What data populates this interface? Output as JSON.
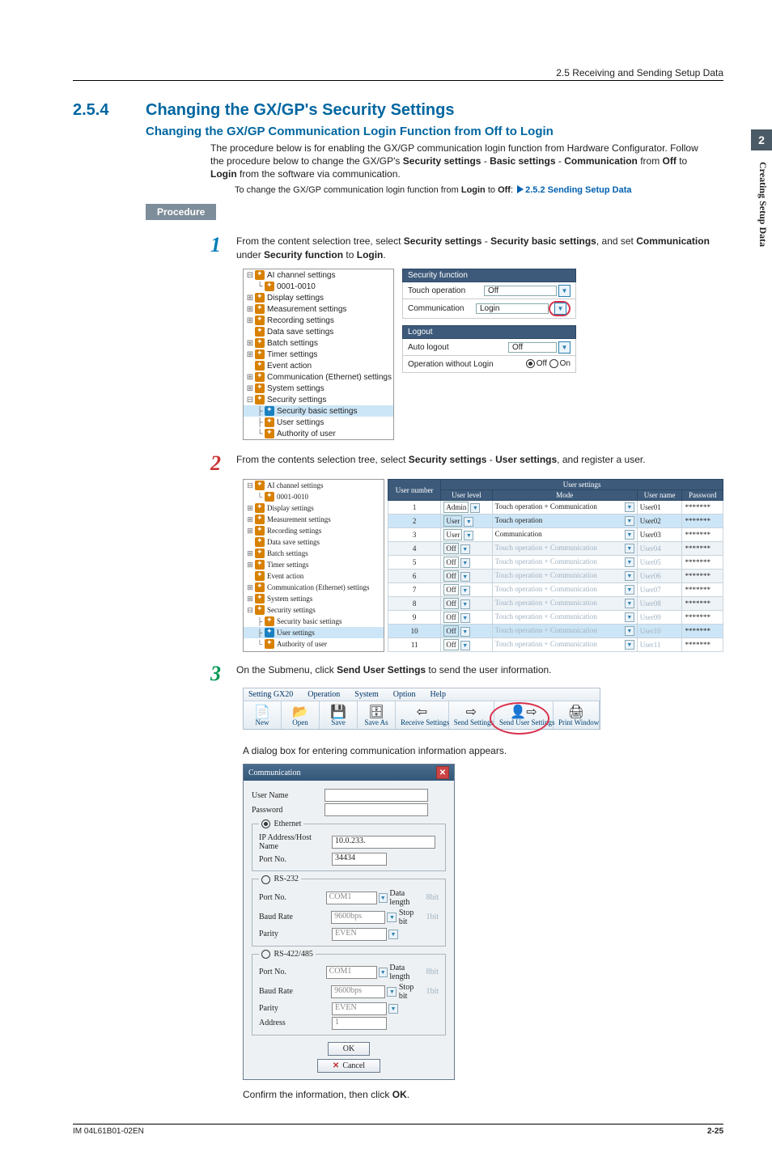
{
  "header": {
    "breadcrumb": "2.5  Receiving and Sending Setup Data"
  },
  "side": {
    "num": "2",
    "label": "Creating Setup Data"
  },
  "section": {
    "number": "2.5.4",
    "title": "Changing the GX/GP's Security Settings"
  },
  "subsection": "Changing the GX/GP Communication Login Function from Off to Login",
  "intro1": "The procedure below is for enabling the GX/GP communication login function from Hardware Configurator. Follow the procedure below to change the GX/GP's ",
  "intro_bold": [
    "Security settings",
    "Basic settings",
    "Communication",
    "Off",
    "Login"
  ],
  "intro_mid1": " - ",
  "intro_mid2": " from ",
  "intro_mid3": " to ",
  "intro_tail": " from the software via communication.",
  "intro2a": "To change the GX/GP  communication login function from ",
  "intro2b": "Login",
  "intro2c": " to ",
  "intro2d": "Off",
  "intro2e": ": ",
  "xref": "2.5.2 Sending Setup Data",
  "procedure_label": "Procedure",
  "step1": {
    "num": "1",
    "t1": "From the content selection tree, select ",
    "b1": "Security settings",
    "t2": " - ",
    "b2": "Security basic settings",
    "t3": ", and set ",
    "b3": "Communication",
    "t4": " under ",
    "b4": "Security function",
    "t5": " to ",
    "b5": "Login",
    "t6": ".",
    "tree": [
      "AI channel settings",
      "0001-0010",
      "Display settings",
      "Measurement settings",
      "Recording settings",
      "Data save settings",
      "Batch settings",
      "Timer settings",
      "Event action",
      "Communication (Ethernet) settings",
      "System settings",
      "Security settings",
      "Security basic settings",
      "User settings",
      "Authority of user"
    ],
    "panel1_title": "Security function",
    "p1_r1_l": "Touch operation",
    "p1_r1_v": "Off",
    "p1_r2_l": "Communication",
    "p1_r2_v": "Login",
    "panel2_title": "Logout",
    "p2_r1_l": "Auto logout",
    "p2_r1_v": "Off",
    "p2_r2_l": "Operation without Login",
    "p2_r2_off": "Off",
    "p2_r2_on": "On"
  },
  "step2": {
    "num": "2",
    "t1": "From the contents selection tree, select ",
    "b1": "Security settings",
    "t2": " - ",
    "b2": "User settings",
    "t3": ", and register a user.",
    "tree": [
      "AI channel settings",
      "0001-0010",
      "Display settings",
      "Measurement settings",
      "Recording settings",
      "Data save settings",
      "Batch settings",
      "Timer settings",
      "Event action",
      "Communication (Ethernet) settings",
      "System settings",
      "Security settings",
      "Security basic settings",
      "User settings",
      "Authority of user"
    ],
    "th_super": "User settings",
    "th": [
      "User number",
      "User level",
      "Mode",
      "User name",
      "Password"
    ],
    "rows": [
      {
        "n": "1",
        "lvl": "Admin",
        "mode": "Touch operation + Communication",
        "user": "User01",
        "pw": "*******",
        "dim": false
      },
      {
        "n": "2",
        "lvl": "User",
        "mode": "Touch operation",
        "user": "User02",
        "pw": "*******",
        "dim": false,
        "sel": true
      },
      {
        "n": "3",
        "lvl": "User",
        "mode": "Communication",
        "user": "User03",
        "pw": "*******",
        "dim": false
      },
      {
        "n": "4",
        "lvl": "Off",
        "mode": "Touch operation + Communication",
        "user": "User04",
        "pw": "*******",
        "dim": true,
        "alt": true
      },
      {
        "n": "5",
        "lvl": "Off",
        "mode": "Touch operation + Communication",
        "user": "User05",
        "pw": "*******",
        "dim": true
      },
      {
        "n": "6",
        "lvl": "Off",
        "mode": "Touch operation + Communication",
        "user": "User06",
        "pw": "*******",
        "dim": true,
        "alt": true
      },
      {
        "n": "7",
        "lvl": "Off",
        "mode": "Touch operation + Communication",
        "user": "User07",
        "pw": "*******",
        "dim": true
      },
      {
        "n": "8",
        "lvl": "Off",
        "mode": "Touch operation + Communication",
        "user": "User08",
        "pw": "*******",
        "dim": true,
        "alt": true
      },
      {
        "n": "9",
        "lvl": "Off",
        "mode": "Touch operation + Communication",
        "user": "User09",
        "pw": "*******",
        "dim": true
      },
      {
        "n": "10",
        "lvl": "Off",
        "mode": "Touch operation + Communication",
        "user": "User10",
        "pw": "*******",
        "dim": true,
        "sel": true
      },
      {
        "n": "11",
        "lvl": "Off",
        "mode": "Touch operation + Communication",
        "user": "User11",
        "pw": "*******",
        "dim": true
      }
    ]
  },
  "step3": {
    "num": "3",
    "t1": "On the Submenu, click ",
    "b1": "Send User Settings",
    "t2": " to send the user information.",
    "menus": [
      "Setting GX20",
      "Operation",
      "System",
      "Option",
      "Help"
    ],
    "buttons": [
      {
        "icon": "📄",
        "label": "New"
      },
      {
        "icon": "📂",
        "label": "Open"
      },
      {
        "icon": "💾",
        "label": "Save"
      },
      {
        "icon": "🗄",
        "label": "Save As"
      },
      {
        "icon": "⇦",
        "label": "Receive Settings"
      },
      {
        "icon": "⇨",
        "label": "Send Settings"
      },
      {
        "icon": "👤⇨",
        "label": "Send User Settings",
        "hl": true
      },
      {
        "icon": "🖨",
        "label": "Print Window"
      }
    ],
    "note1": "A dialog box for entering communication information appears.",
    "dlg": {
      "title": "Communication",
      "user_l": "User Name",
      "user_v": "",
      "pw_l": "Password",
      "pw_v": "",
      "grp_eth": "Ethernet",
      "ip_l": "IP Address/Host Name",
      "ip_v": "10.0.233.",
      "port_l": "Port No.",
      "port_v": "34434",
      "grp_232": "RS-232",
      "pn_l": "Port No.",
      "pn_v": "COM1",
      "dl_l": "Data length",
      "dl_v": "8bit",
      "br_l": "Baud Rate",
      "br_v": "9600bps",
      "sb_l": "Stop bit",
      "sb_v": "1bit",
      "par_l": "Parity",
      "par_v": "EVEN",
      "grp_485": "RS-422/485",
      "addr_l": "Address",
      "addr_v": "1",
      "ok": "OK",
      "cancel": "Cancel"
    },
    "note2": "Confirm the information, then click ",
    "note2b": "OK",
    "note2c": "."
  },
  "footer": {
    "left": "IM 04L61B01-02EN",
    "right": "2-25"
  }
}
